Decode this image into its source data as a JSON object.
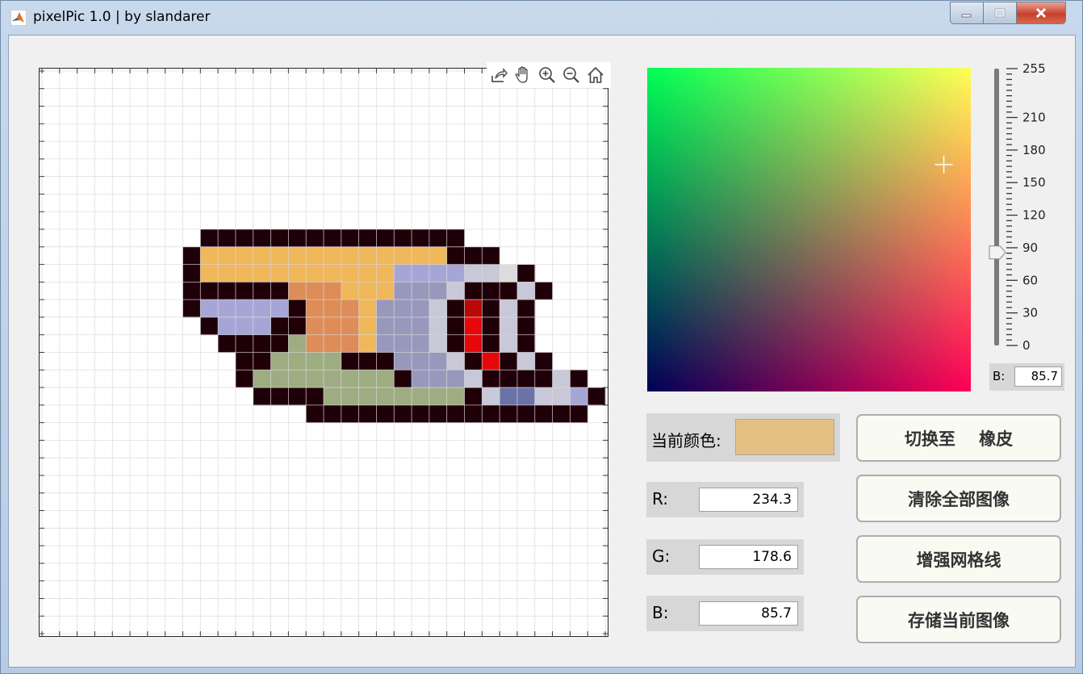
{
  "window": {
    "title": "pixelPic 1.0 | by slandarer",
    "minimize_icon": "minimize-icon",
    "maximize_icon": "maximize-icon",
    "close_icon": "close-icon"
  },
  "axes_toolbar": [
    "export-icon",
    "pan-hand-icon",
    "zoom-in-icon",
    "zoom-out-icon",
    "home-icon"
  ],
  "canvas": {
    "grid_columns": 32,
    "grid_rows": 32,
    "palette": {
      "k": "#200008",
      "y": "#f0b85a",
      "o": "#de8c58",
      "l": "#a6a6d6",
      "m": "#9898bc",
      "w": "#c8c8d8",
      "s": "#dcdcdc",
      "r": "#e60808",
      "d": "#b80808",
      "g": "#9eac82",
      "n": "#6a72a6"
    },
    "pixel_rows": [
      "................................",
      "................................",
      "................................",
      "................................",
      "................................",
      "................................",
      "................................",
      "................................",
      "................................",
      ".........kkkkkkkkkkkkkkk........",
      "........kyyyyyyyyyyyyyykkk......",
      "........kyyyyyyyyyyyllllwwsk....",
      "........kkkkkkoooyyymmmwkkkwk...",
      "........klllllkoooymmmwkdkwk....",
      ".........klllkkoooymmmwkrkwk....",
      "..........kkkkgoooymmmwkrkwk....",
      "...........kkggggkkkmmmwkrkwk...",
      "...........kggggggggkmmmwkkkkwk..",
      "............kkkkggggggggkwnnwwlk..",
      "...............kkkkkkkkkkkkkkkk..",
      "................................",
      "................................",
      "................................",
      "................................",
      "................................",
      "................................",
      "................................",
      "................................",
      "................................",
      "................................",
      "................................",
      "................................"
    ]
  },
  "color_picker": {
    "b_value": 85.7,
    "cursor_r": 234.3,
    "cursor_g": 178.6,
    "slider": {
      "min": 0,
      "max": 255,
      "value": 85.7,
      "tick_labels": [
        "255",
        "210",
        "180",
        "150",
        "120",
        "90",
        "60",
        "30",
        "0"
      ],
      "tick_values": [
        255,
        210,
        180,
        150,
        120,
        90,
        60,
        30,
        0
      ]
    },
    "readout_label": "B:",
    "readout_value": "85.7"
  },
  "current_color": {
    "label": "当前颜色:",
    "swatch_hex": "#e4c084"
  },
  "rgb_fields": [
    {
      "label": "R:",
      "value": "234.3"
    },
    {
      "label": "G:",
      "value": "178.6"
    },
    {
      "label": "B:",
      "value": "85.7"
    }
  ],
  "buttons": {
    "toggle_eraser": "切换至    橡皮",
    "clear_all": "清除全部图像",
    "enhance_grid": "增强网格线",
    "save_image": "存储当前图像"
  }
}
